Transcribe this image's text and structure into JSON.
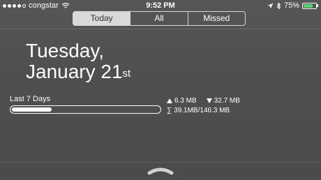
{
  "status_bar": {
    "carrier": "congstar",
    "time": "9:52 PM",
    "battery_percent": "75%",
    "signal_bars_filled": 4,
    "signal_bars_total": 5,
    "battery_level": 0.75,
    "battery_color": "#4cd964"
  },
  "tabs": [
    {
      "label": "Today",
      "active": true
    },
    {
      "label": "All",
      "active": false
    },
    {
      "label": "Missed",
      "active": false
    }
  ],
  "date": {
    "line1": "Tuesday,",
    "line2": "January 21",
    "suffix": "st"
  },
  "usage": {
    "label": "Last 7 Days",
    "progress": 0.27,
    "upload": "6.3 MB",
    "download": "32.7 MB",
    "total": "39.1MB/146.3 MB",
    "total_symbol": "∑"
  },
  "icons": [
    "wifi-icon",
    "location-arrow-icon",
    "bluetooth-icon",
    "battery-icon",
    "upload-arrow-icon",
    "download-arrow-icon",
    "grabber-chevron-icon"
  ]
}
